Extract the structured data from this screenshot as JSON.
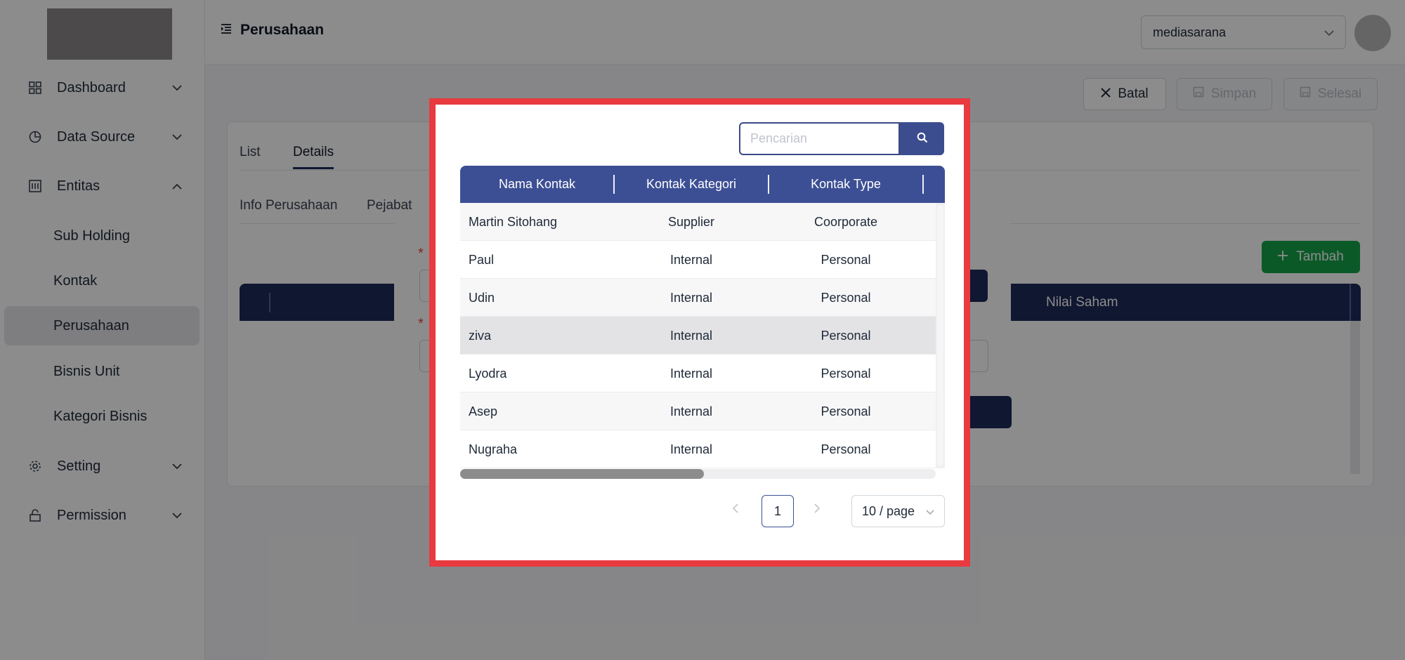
{
  "sidebar": {
    "items": [
      {
        "label": "Dashboard",
        "icon": "grid-icon",
        "expanded": false
      },
      {
        "label": "Data Source",
        "icon": "pie-chart-icon",
        "expanded": false
      },
      {
        "label": "Entitas",
        "icon": "table-icon",
        "expanded": true
      },
      {
        "label": "Setting",
        "icon": "gear-icon",
        "expanded": false
      },
      {
        "label": "Permission",
        "icon": "lock-icon",
        "expanded": false
      }
    ],
    "sub_items": [
      {
        "label": "Sub Holding"
      },
      {
        "label": "Kontak"
      },
      {
        "label": "Perusahaan",
        "active": true
      },
      {
        "label": "Bisnis Unit"
      },
      {
        "label": "Kategori Bisnis"
      }
    ]
  },
  "header": {
    "title": "Perusahaan",
    "company_select": "mediasarana"
  },
  "actions": {
    "cancel": "Batal",
    "save": "Simpan",
    "finish": "Selesai"
  },
  "tabs": {
    "main": [
      "List",
      "Details"
    ],
    "sub": [
      "Info Perusahaan",
      "Pejabat"
    ]
  },
  "background_table": {
    "add_label": "Tambah",
    "column": "Nilai Saham"
  },
  "modal": {
    "search": {
      "placeholder": "Pencarian",
      "value": ""
    },
    "columns": [
      "Nama Kontak",
      "Kontak Kategori",
      "Kontak Type"
    ],
    "rows": [
      {
        "name": "Martin Sitohang",
        "category": "Supplier",
        "type": "Coorporate"
      },
      {
        "name": "Paul",
        "category": "Internal",
        "type": "Personal"
      },
      {
        "name": "Udin",
        "category": "Internal",
        "type": "Personal"
      },
      {
        "name": "ziva",
        "category": "Internal",
        "type": "Personal"
      },
      {
        "name": "Lyodra",
        "category": "Internal",
        "type": "Personal"
      },
      {
        "name": "Asep",
        "category": "Internal",
        "type": "Personal"
      },
      {
        "name": "Nugraha",
        "category": "Internal",
        "type": "Personal"
      }
    ],
    "pagination": {
      "current_page": "1",
      "page_size": "10 / page"
    }
  },
  "colors": {
    "accent": "#3d4f94",
    "highlight_frame": "#e83a3f",
    "add_button": "#16a34a",
    "dark_navy": "#1e2a5a"
  }
}
